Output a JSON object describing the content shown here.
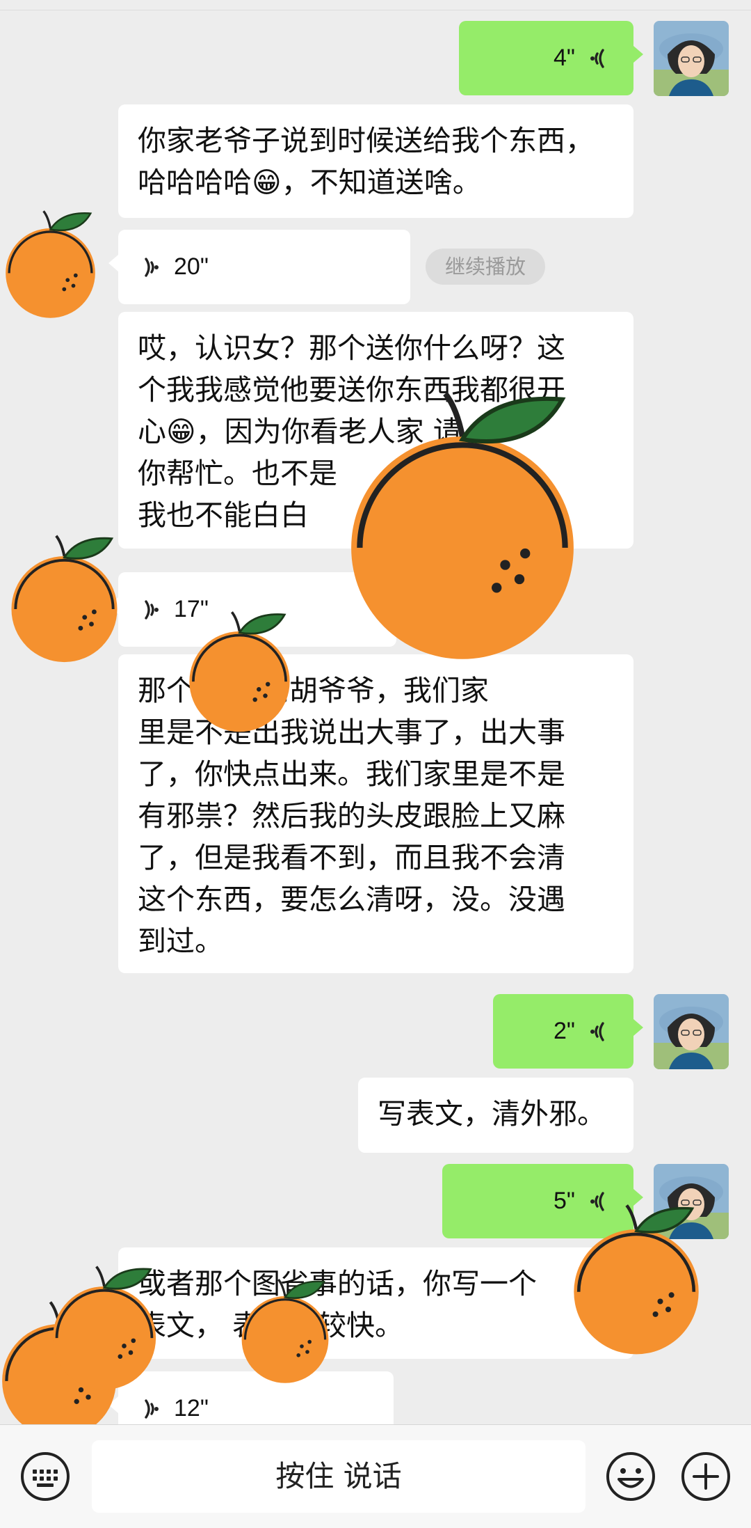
{
  "messages": [
    {
      "type": "voice",
      "side": "out",
      "duration": "4\""
    },
    {
      "type": "text",
      "side": "in",
      "lines": [
        "你家老爷子说到时候送给我个东西，",
        "哈哈哈哈😁，不知道送啥。"
      ]
    },
    {
      "type": "voice",
      "side": "in",
      "duration": "20\""
    },
    {
      "type": "text",
      "side": "in",
      "lines": [
        "哎，认识女？那个送你什么呀？这",
        "个我我感觉他要送你东西我都很开",
        "心😁，因为你看老人家 请",
        "你帮忙。也不是",
        "我也不能白白"
      ]
    },
    {
      "type": "voice",
      "side": "in",
      "duration": "17\""
    },
    {
      "type": "text",
      "side": "in",
      "lines": [
        "那个 我一问胡爷爷，我们家",
        "里是不是出我说出大事了，出大事",
        "了，你快点出来。我们家里是不是",
        "有邪祟？然后我的头皮跟脸上又麻",
        "了，但是我看不到，而且我不会清",
        "这个东西，要怎么清呀，没。没遇",
        "到过。"
      ]
    },
    {
      "type": "voice",
      "side": "out",
      "duration": "2\""
    },
    {
      "type": "text",
      "side": "out",
      "lines": [
        "写表文，清外邪。"
      ]
    },
    {
      "type": "voice",
      "side": "out",
      "duration": "5\""
    },
    {
      "type": "text",
      "side": "in",
      "lines": [
        "或者那个图省事的话，你写一个",
        "表文， 表文比较快。"
      ]
    },
    {
      "type": "voice",
      "side": "in",
      "duration": "12\""
    }
  ],
  "continue_play_label": "继续播放",
  "input_bar": {
    "hold_to_talk_label": "按住 说话",
    "icons": [
      "keyboard-icon",
      "emoji-icon",
      "plus-icon"
    ]
  },
  "colors": {
    "incoming": "#ffffff",
    "outgoing": "#95ec69",
    "background": "#ededed"
  }
}
